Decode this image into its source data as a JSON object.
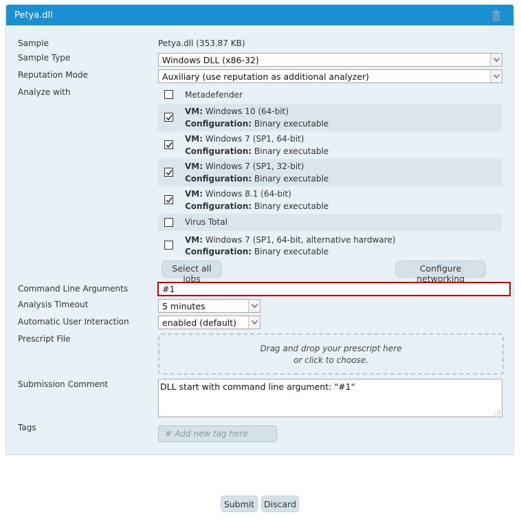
{
  "header": {
    "title": "Petya.dll",
    "delete_icon": "trash-icon"
  },
  "sample": {
    "label": "Sample",
    "value": "Petya.dll (353.87 KB)"
  },
  "sample_type": {
    "label": "Sample Type",
    "selected": "Windows DLL (x86-32)"
  },
  "reputation_mode": {
    "label": "Reputation Mode",
    "selected": "Auxiliary (use reputation as additional analyzer)"
  },
  "analyze_with": {
    "label": "Analyze with",
    "jobs": [
      {
        "checked": false,
        "name": "Metadefender"
      },
      {
        "checked": true,
        "vm_label": "VM:",
        "vm": "Windows 10 (64-bit)",
        "config_label": "Configuration:",
        "config": "Binary executable"
      },
      {
        "checked": true,
        "vm_label": "VM:",
        "vm": "Windows 7 (SP1, 64-bit)",
        "config_label": "Configuration:",
        "config": "Binary executable"
      },
      {
        "checked": true,
        "vm_label": "VM:",
        "vm": "Windows 7 (SP1, 32-bit)",
        "config_label": "Configuration:",
        "config": "Binary executable"
      },
      {
        "checked": true,
        "vm_label": "VM:",
        "vm": "Windows 8.1 (64-bit)",
        "config_label": "Configuration:",
        "config": "Binary executable"
      },
      {
        "checked": false,
        "name": "Virus Total"
      },
      {
        "checked": false,
        "vm_label": "VM:",
        "vm": "Windows 7 (SP1, 64-bit, alternative hardware)",
        "config_label": "Configuration:",
        "config": "Binary executable"
      }
    ],
    "select_all_label": "Select all jobs",
    "configure_networking_label": "Configure networking"
  },
  "command_line": {
    "label": "Command Line Arguments",
    "value": "#1"
  },
  "timeout": {
    "label": "Analysis Timeout",
    "selected": "5 minutes"
  },
  "user_interaction": {
    "label": "Automatic User Interaction",
    "selected": "enabled (default)"
  },
  "prescript": {
    "label": "Prescript File",
    "drop_line1": "Drag and drop your prescript here",
    "drop_line2": "or click to choose."
  },
  "comment": {
    "label": "Submission Comment",
    "value": "DLL start with command line argument: \"#1\""
  },
  "tags": {
    "label": "Tags",
    "hash": "#",
    "placeholder": "Add new tag here"
  },
  "actions": {
    "submit_label": "Submit",
    "discard_label": "Discard"
  },
  "colors": {
    "header_bg": "#1a8fd1",
    "panel_bg": "#e8f1f6",
    "error_border": "#d10000",
    "button_bg": "#d5e1e8"
  }
}
